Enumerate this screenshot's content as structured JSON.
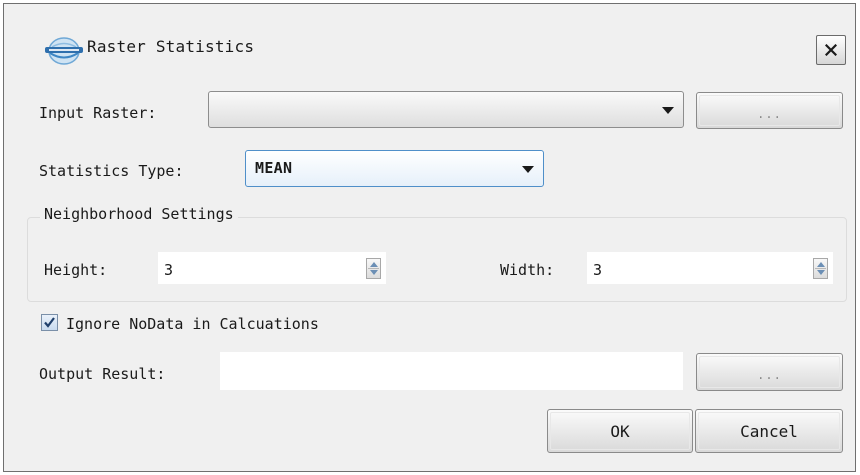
{
  "window": {
    "title": "Raster Statistics",
    "logo_icon": "globe-logo-icon",
    "close_icon": "close-icon"
  },
  "input_raster": {
    "label": "Input Raster:",
    "value": "",
    "browse_label": "..."
  },
  "statistics_type": {
    "label": "Statistics Type:",
    "value": "MEAN"
  },
  "neighborhood": {
    "title": "Neighborhood Settings",
    "height_label": "Height:",
    "height_value": "3",
    "width_label": "Width:",
    "width_value": "3"
  },
  "ignore_nodata": {
    "label": "Ignore NoData in Calcuations",
    "checked": true
  },
  "output_result": {
    "label": "Output Result:",
    "value": "",
    "browse_label": "..."
  },
  "buttons": {
    "ok": "OK",
    "cancel": "Cancel"
  },
  "colors": {
    "accent": "#4f8fc9",
    "dialog_bg": "#f0f0f0",
    "spinner_arrow": "#6c8fb5"
  }
}
